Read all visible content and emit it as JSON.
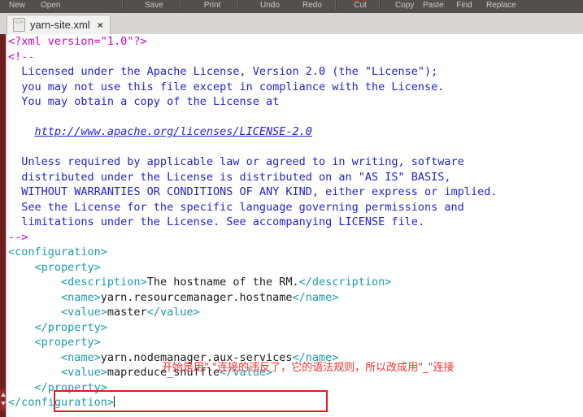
{
  "window": {
    "app": "gedit-text-editor"
  },
  "toolbar": {
    "items": [
      {
        "name": "new-document-button",
        "icon": "new-document-icon",
        "label": "New"
      },
      {
        "name": "open-file-button",
        "icon": "folder-open-icon",
        "label": "Open"
      },
      {
        "name": "save-file-button",
        "icon": "save-disk-icon",
        "label": "Save"
      },
      {
        "name": "print-button",
        "icon": "printer-icon",
        "label": "Print"
      },
      {
        "name": "undo-button",
        "icon": "undo-arrow-icon",
        "label": "Undo"
      },
      {
        "name": "redo-button",
        "icon": "redo-arrow-icon",
        "label": "Redo"
      },
      {
        "name": "cut-button",
        "icon": "scissors-icon",
        "label": "Cut"
      },
      {
        "name": "copy-button",
        "icon": "copy-icon",
        "label": "Copy"
      },
      {
        "name": "paste-button",
        "icon": "paste-icon",
        "label": "Paste"
      },
      {
        "name": "find-button",
        "icon": "magnifier-icon",
        "label": "Find"
      },
      {
        "name": "replace-button",
        "icon": "find-replace-icon",
        "label": "Replace"
      }
    ]
  },
  "tab": {
    "title": "yarn-site.xml",
    "close_label": "×",
    "icon": "xml-file-icon"
  },
  "code": {
    "lines": [
      {
        "segments": [
          {
            "cls": "pi",
            "t": "<?xml version=\"1.0\"?>"
          }
        ]
      },
      {
        "segments": [
          {
            "cls": "pi",
            "t": "<!--"
          }
        ]
      },
      {
        "segments": [
          {
            "cls": "cmt",
            "t": "  Licensed under the Apache License, Version 2.0 (the \"License\");"
          }
        ]
      },
      {
        "segments": [
          {
            "cls": "cmt",
            "t": "  you may not use this file except in compliance with the License."
          }
        ]
      },
      {
        "segments": [
          {
            "cls": "cmt",
            "t": "  You may obtain a copy of the License at"
          }
        ]
      },
      {
        "segments": [
          {
            "cls": "cmt",
            "t": ""
          }
        ]
      },
      {
        "segments": [
          {
            "cls": "cmt",
            "t": "    "
          },
          {
            "cls": "cmt-url",
            "t": "http://www.apache.org/licenses/LICENSE-2.0"
          }
        ]
      },
      {
        "segments": [
          {
            "cls": "cmt",
            "t": ""
          }
        ]
      },
      {
        "segments": [
          {
            "cls": "cmt",
            "t": "  Unless required by applicable law or agreed to in writing, software"
          }
        ]
      },
      {
        "segments": [
          {
            "cls": "cmt",
            "t": "  distributed under the License is distributed on an \"AS IS\" BASIS,"
          }
        ]
      },
      {
        "segments": [
          {
            "cls": "cmt",
            "t": "  WITHOUT WARRANTIES OR CONDITIONS OF ANY KIND, either express or implied."
          }
        ]
      },
      {
        "segments": [
          {
            "cls": "cmt",
            "t": "  See the License for the specific language governing permissions and"
          }
        ]
      },
      {
        "segments": [
          {
            "cls": "cmt",
            "t": "  limitations under the License. See accompanying LICENSE file."
          }
        ]
      },
      {
        "segments": [
          {
            "cls": "pi",
            "t": "-->"
          }
        ]
      },
      {
        "segments": [
          {
            "cls": "tag",
            "t": "<configuration>"
          }
        ]
      },
      {
        "segments": [
          {
            "cls": "tag",
            "t": "    <property>"
          }
        ]
      },
      {
        "segments": [
          {
            "cls": "tag",
            "t": "        <description>"
          },
          {
            "cls": "txt",
            "t": "The hostname of the RM."
          },
          {
            "cls": "tag",
            "t": "</description>"
          }
        ]
      },
      {
        "segments": [
          {
            "cls": "tag",
            "t": "        <name>"
          },
          {
            "cls": "txt",
            "t": "yarn.resourcemanager.hostname"
          },
          {
            "cls": "tag",
            "t": "</name>"
          }
        ]
      },
      {
        "segments": [
          {
            "cls": "tag",
            "t": "        <value>"
          },
          {
            "cls": "txt",
            "t": "master"
          },
          {
            "cls": "tag",
            "t": "</value>"
          }
        ]
      },
      {
        "segments": [
          {
            "cls": "tag",
            "t": "    </property>"
          }
        ]
      },
      {
        "segments": [
          {
            "cls": "tag",
            "t": "    <property>"
          }
        ]
      },
      {
        "segments": [
          {
            "cls": "tag",
            "t": "        <name>"
          },
          {
            "cls": "txt",
            "t": "yarn.nodemanager.aux-services"
          },
          {
            "cls": "tag",
            "t": "</name>"
          }
        ]
      },
      {
        "segments": [
          {
            "cls": "tag",
            "t": "        <value>"
          },
          {
            "cls": "txt",
            "t": "mapreduce_shuffle"
          },
          {
            "cls": "tag",
            "t": "</value>"
          }
        ]
      },
      {
        "segments": [
          {
            "cls": "tag",
            "t": "    </property>"
          }
        ]
      },
      {
        "segments": [
          {
            "cls": "tag",
            "t": "</configuration>"
          },
          {
            "cls": "caret",
            "t": ""
          }
        ]
      }
    ]
  },
  "annotations": {
    "note_text": "开始是用\".\"连接的违反了，它的语法规则，所以改成用\"_\"连接",
    "note_color": "#ff2d2d",
    "highlight_box_color": "#e01b1b",
    "highlight_target": "<value>mapreduce_shuffle</value>"
  },
  "colors": {
    "toolbar_bg": "#534f4b",
    "tabbar_bg": "#d9d6d1",
    "editor_bg": "#ffffff",
    "gutter_bar": "#6e1f1f",
    "xml_tag": "#1b9aaa",
    "xml_comment": "#2222cc",
    "xml_pi": "#cc00cc"
  }
}
